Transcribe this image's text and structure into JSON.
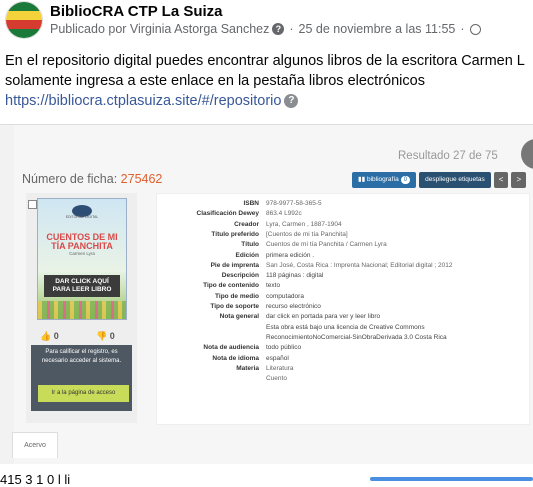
{
  "post": {
    "page_name": "BiblioCRA CTP La Suiza",
    "published_by": "Publicado por Virginia Astorga Sanchez",
    "date": "25 de noviembre a las 11:55",
    "line1": "En el repositorio digital puedes encontrar algunos libros de la escritora Carmen L",
    "line2": "solamente ingresa a este enlace en la pestaña libros electrónicos",
    "link": "https://bibliocra.ctplasuiza.site/#/repositorio"
  },
  "catalog": {
    "resultado": "Resultado 27 de 75",
    "ficha_label": "Número de ficha:",
    "ficha_number": "275462",
    "buttons": {
      "bibliografia": "bibliografía",
      "bibliografia_count": "0",
      "despliegue": "despliegue etiquetas",
      "prev": "<",
      "next": ">"
    },
    "cover": {
      "publisher": "EDITORIAL DIGITAL",
      "title_line1": "CUENTOS DE MI",
      "title_line2": "TÍA PANCHITA",
      "author": "Carmen Lyra",
      "cta_line1": "DAR CLICK AQUÍ",
      "cta_line2": "PARA LEER LIBRO"
    },
    "thumbs": {
      "up": "0",
      "down": "0"
    },
    "notice": "Para calificar el registro, es necesario acceder al sistema.",
    "login_button": "Ir a la página de acceso",
    "fields": [
      {
        "label": "ISBN",
        "value": "978-9977-58-365-5"
      },
      {
        "label": "Clasificación Dewey",
        "value": "863.4 L992c"
      },
      {
        "label": "Creador",
        "value": "Lyra, Carmen , 1887-1904"
      },
      {
        "label": "Título preferido",
        "value": "[Cuentos de mi tía Panchita]"
      },
      {
        "label": "Título",
        "value": "Cuentos de mi tía Panchita / Carmen Lyra"
      },
      {
        "label": "Edición",
        "value": "primera edición ."
      },
      {
        "label": "Pie de imprenta",
        "value": "San José, Costa Rica : Imprenta Nacional; Editorial digital ; 2012"
      },
      {
        "label": "Descripción",
        "value": "118 páginas : digital"
      },
      {
        "label": "Tipo de contenido",
        "value": "texto"
      },
      {
        "label": "Tipo de medio",
        "value": "computadora"
      },
      {
        "label": "Tipo de soporte",
        "value": "recurso electrónico"
      },
      {
        "label": "Nota general",
        "value": "dar click en portada para ver y leer libro"
      },
      {
        "label": "",
        "value": "Esta obra está bajo una licencia de Creative Commons"
      },
      {
        "label": "",
        "value": "ReconocimientoNoComercial-SinObraDerivada 3.0 Costa Rica"
      },
      {
        "label": "Nota de audiencia",
        "value": "todo público"
      },
      {
        "label": "Nota de idioma",
        "value": "español"
      },
      {
        "label": "Materia",
        "value": "Literatura"
      },
      {
        "label": "",
        "value": "Cuento"
      }
    ],
    "tab": "Acervo"
  },
  "footer_cut": "415                    3                    1 0       l       li"
}
